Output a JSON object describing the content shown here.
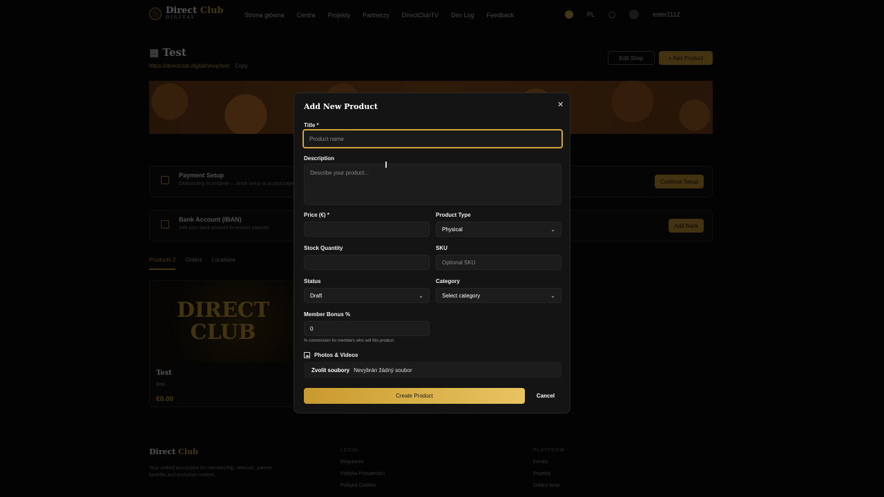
{
  "nav": {
    "brand_a": "Direct",
    "brand_b": "Club",
    "brand_sub": "DIGITAL",
    "links": [
      "Strona główna",
      "Centra",
      "Projekty",
      "Partnerzy",
      "DirectClubTV",
      "Dev Log",
      "Feedback"
    ],
    "lang": "PL",
    "user": "ester2112"
  },
  "shop": {
    "title": "Test",
    "url": "https://directclub.digital/shop/test",
    "copy_label": "Copy",
    "edit_label": "Edit Shop",
    "add_label": "+ Add Product"
  },
  "setup": {
    "payment_title": "Payment Setup",
    "payment_sub": "Onboarding incomplete — finish setup to accept payments",
    "payment_btn": "Continue Setup",
    "bank_title": "Bank Account (IBAN)",
    "bank_sub": "Add your bank account to receive payouts",
    "bank_btn": "Add Bank"
  },
  "tabs": {
    "products": "Products",
    "products_count": "2",
    "orders": "Orders",
    "locations": "Locations"
  },
  "product_card": {
    "image_text_1": "DIRECT",
    "image_text_2": "CLUB",
    "name": "Test",
    "desc": "test",
    "price": "€0.00"
  },
  "footer": {
    "brand_a": "Direct",
    "brand_b": "Club",
    "text": "Your unified ecosystem for membership, referrals, partner benefits and exclusive content.",
    "col1_head": "LEGAL",
    "col1_items": [
      "Regulamin",
      "Polityka Prywatności",
      "Polityka Cookies"
    ],
    "col2_head": "PLATFORM",
    "col2_items": [
      "Centra",
      "Projekty",
      "Dołącz teraz"
    ]
  },
  "modal": {
    "title": "Add New Product",
    "close": "✕",
    "title_label": "Title *",
    "title_placeholder": "Product name",
    "description_label": "Description",
    "description_placeholder": "Describe your product...",
    "price_label": "Price (€) *",
    "price_value": "",
    "type_label": "Product Type",
    "type_value": "Physical",
    "stock_label": "Stock Quantity",
    "stock_value": "",
    "sku_label": "SKU",
    "sku_placeholder": "Optional SKU",
    "status_label": "Status",
    "status_value": "Draft",
    "category_label": "Category",
    "category_value": "Select category",
    "bonus_label": "Member Bonus %",
    "bonus_value": "0",
    "bonus_help": "% commission for members who sell this product",
    "photos_label": "Photos & Videos",
    "file_button": "Zvolit soubory",
    "file_status": "Nevybrán žádný soubor",
    "create_label": "Create Product",
    "cancel_label": "Cancel"
  },
  "colors": {
    "accent": "#d4a63a",
    "modal_bg": "#141414",
    "page_bg": "#030303"
  },
  "icons": [
    "shop-icon",
    "close-icon",
    "chevron-down-icon",
    "image-icon",
    "card-icon",
    "bank-icon"
  ]
}
